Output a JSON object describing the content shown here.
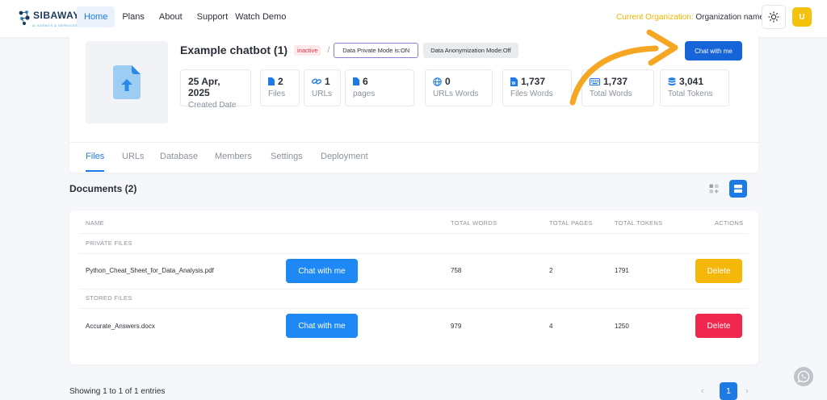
{
  "brand": {
    "name": "SIBAWAY",
    "tagline": "AI AGENTS & SERVICES"
  },
  "nav": {
    "home": "Home",
    "plans": "Plans",
    "about": "About",
    "support": "Support",
    "demo": "Watch Demo"
  },
  "org": {
    "label": "Current Organization:",
    "value": "Organization name"
  },
  "user": {
    "initial": "U"
  },
  "bot": {
    "title": "Example chatbot (1)",
    "status": "inactive",
    "separator": "/",
    "private_mode": "Data Private Mode is:ON",
    "anon_mode": "Data Anonymization Mode:Off",
    "chat_label": "Chat with me"
  },
  "stats": [
    {
      "value": "25 Apr, 2025",
      "label": "Created Date",
      "icon": "none"
    },
    {
      "value": "2",
      "label": "Files",
      "icon": "file-icon"
    },
    {
      "value": "1",
      "label": "URLs",
      "icon": "link-icon"
    },
    {
      "value": "6",
      "label": "pages",
      "icon": "file-icon"
    },
    {
      "value": "0",
      "label": "URLs Words",
      "icon": "globe-icon"
    },
    {
      "value": "1,737",
      "label": "Files Words",
      "icon": "word-file-icon"
    },
    {
      "value": "1,737",
      "label": "Total Words",
      "icon": "keyboard-icon"
    },
    {
      "value": "3,041",
      "label": "Total Tokens",
      "icon": "database-icon"
    }
  ],
  "tabs": [
    "Files",
    "URLs",
    "Database",
    "Members",
    "Settings",
    "Deployment"
  ],
  "documents": {
    "title": "Documents (2)"
  },
  "table": {
    "headers": {
      "name": "NAME",
      "words": "TOTAL WORDS",
      "pages": "TOTAL PAGES",
      "tokens": "TOTAL TOKENS",
      "actions": "ACTIONS"
    },
    "private_label": "PRIVATE FILES",
    "stored_label": "STORED FILES",
    "rows": [
      {
        "name": "Python_Cheat_Sheet_for_Data_Analysis.pdf",
        "words": "758",
        "pages": "2",
        "tokens": "1791",
        "chat": "Chat with me",
        "delete": "Delete"
      },
      {
        "name": "Accurate_Answers.docx",
        "words": "979",
        "pages": "4",
        "tokens": "1250",
        "chat": "Chat with me",
        "delete": "Delete"
      }
    ]
  },
  "footer": {
    "showing": "Showing 1 to 1 of 1 entries",
    "prev": "‹",
    "page": "1",
    "next": "›"
  },
  "colors": {
    "primary": "#1e7be6",
    "accent_yellow": "#f5b70a",
    "danger": "#f0274f",
    "arrow": "#f5a623"
  }
}
